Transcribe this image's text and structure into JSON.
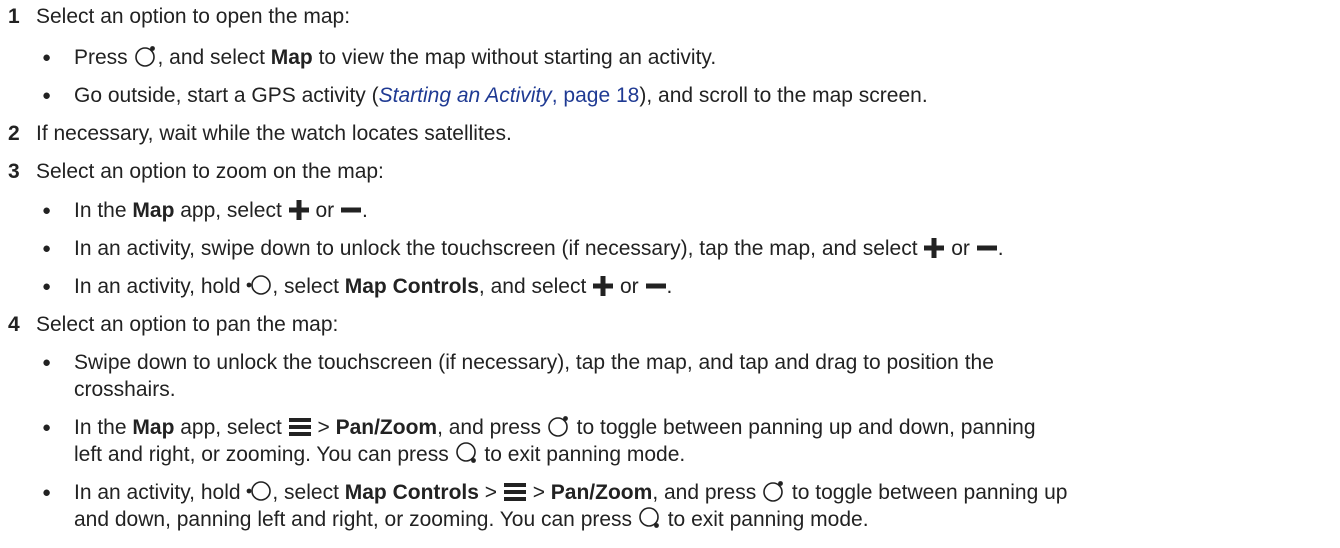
{
  "steps": [
    {
      "number": "1",
      "text": "Select an option to open the map:",
      "bullets": [
        {
          "pre": "Press ",
          "mid1": ", and select ",
          "bold1": "Map",
          "post": " to view the map without starting an activity."
        },
        {
          "pre": "Go outside, start a GPS activity (",
          "link_title": "Starting an Activity",
          "link_page": ", page 18",
          "post": "), and scroll to the map screen."
        }
      ]
    },
    {
      "number": "2",
      "text": "If necessary, wait while the watch locates satellites."
    },
    {
      "number": "3",
      "text": "Select an option to zoom on the map:",
      "bullets": [
        {
          "pre": "In the ",
          "bold1": "Map",
          "mid1": " app, select ",
          "or": " or ",
          "post": "."
        },
        {
          "pre": "In an activity, swipe down to unlock the touchscreen (if necessary), tap the map, and select ",
          "or": " or ",
          "post": "."
        },
        {
          "pre": "In an activity, hold ",
          "mid1": ", select ",
          "bold1": "Map Controls",
          "mid2": ", and select ",
          "or": " or ",
          "post": "."
        }
      ]
    },
    {
      "number": "4",
      "text": "Select an option to pan the map:",
      "bullets": [
        {
          "line1": "Swipe down to unlock the touchscreen (if necessary), tap the map, and tap and drag to position the",
          "line2": "crosshairs."
        },
        {
          "pre": "In the ",
          "bold1": "Map",
          "mid1": " app, select ",
          "gt": " > ",
          "bold2": "Pan/Zoom",
          "mid2": ", and press ",
          "post1": " to toggle between panning up and down, panning",
          "line2_pre": "left and right, or zooming. You can press ",
          "line2_post": " to exit panning mode."
        },
        {
          "pre": "In an activity, hold ",
          "mid1": ", select ",
          "bold1": "Map Controls",
          "gt1": " > ",
          "gt2": " > ",
          "bold2": "Pan/Zoom",
          "mid2": ", and press ",
          "post1": " to toggle between panning up",
          "line2_pre": "and down, panning left and right, or zooming. You can press ",
          "line2_post": " to exit panning mode."
        }
      ]
    }
  ],
  "bullet_glyph": "●",
  "icons": {
    "upper_right_button": "watch-button-top-right-icon",
    "lower_right_button": "watch-button-bottom-right-icon",
    "left_button": "watch-button-left-icon",
    "plus": "plus-icon",
    "minus": "minus-icon",
    "menu": "menu-icon"
  }
}
